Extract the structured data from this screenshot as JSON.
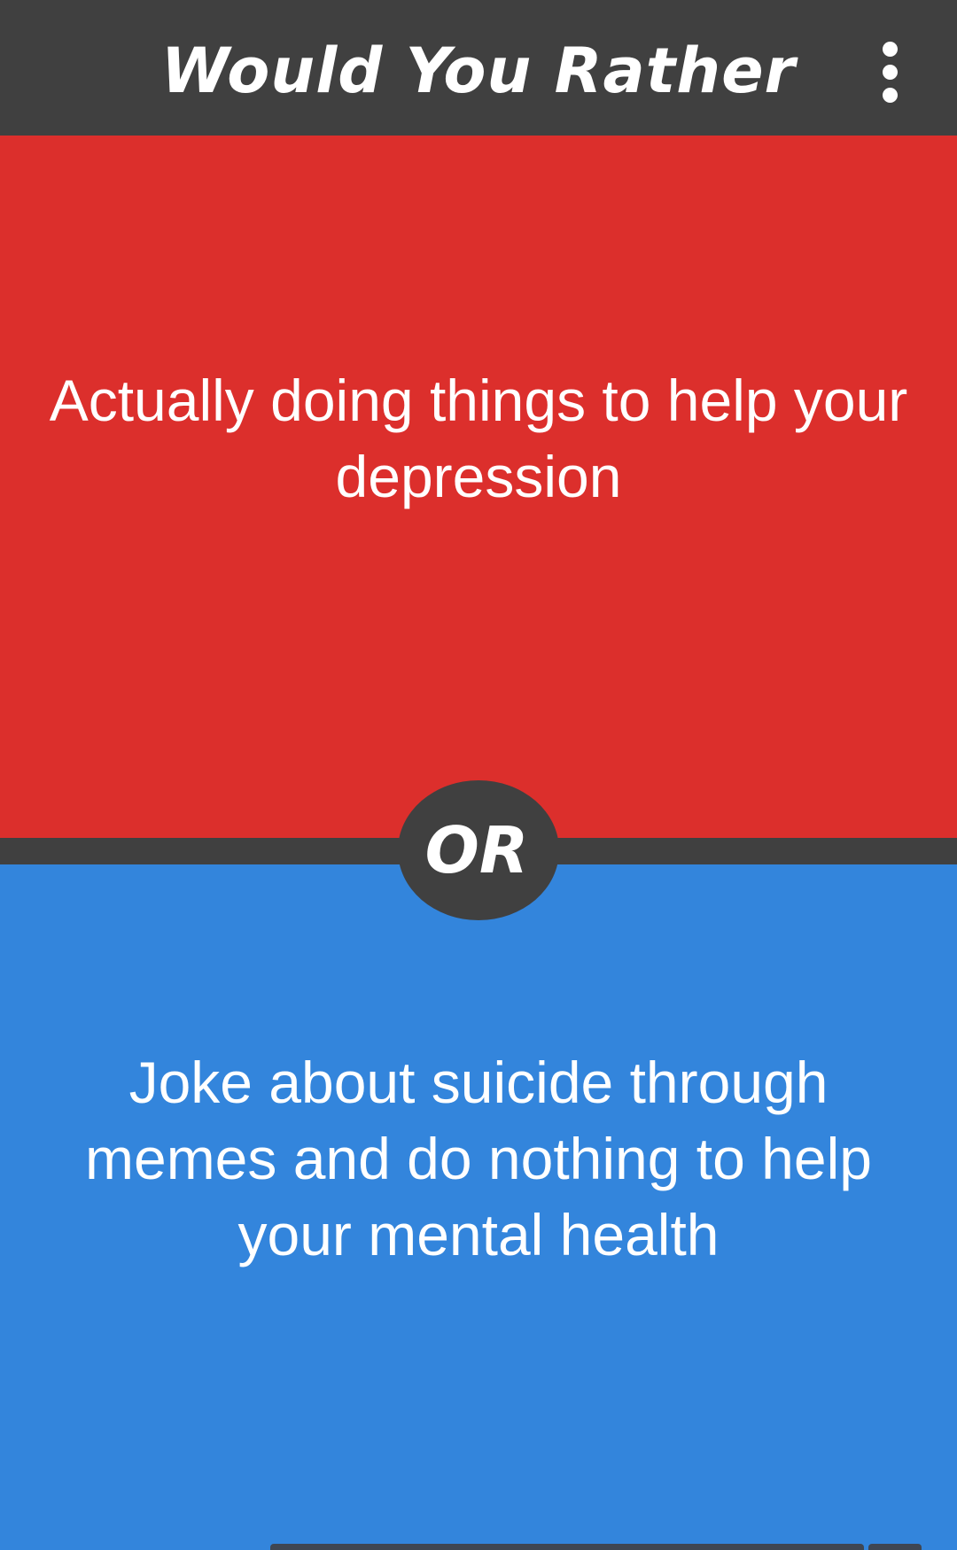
{
  "app_bar": {
    "title": "Would You Rather",
    "menu_icon": "more-vertical-icon"
  },
  "question": {
    "option_a": {
      "text": "Actually doing things to help your depression",
      "color": "#dc2f2c"
    },
    "divider_label": "OR",
    "option_b": {
      "text": "Joke about suicide through memes and do nothing to help your mental health",
      "color": "#3385dc"
    }
  },
  "theme": {
    "bar_color": "#404040",
    "text_color": "#ffffff"
  }
}
